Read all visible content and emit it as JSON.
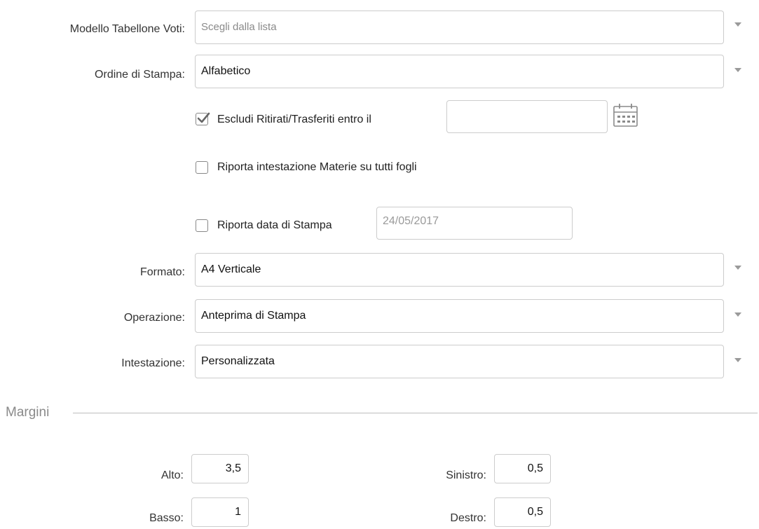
{
  "form": {
    "modello": {
      "label": "Modello Tabellone Voti:",
      "placeholder": "Scegli dalla lista"
    },
    "ordine": {
      "label": "Ordine di Stampa:",
      "value": "Alfabetico"
    },
    "escludi": {
      "label": "Escludi Ritirati/Trasferiti entro il",
      "checked": true,
      "date_value": ""
    },
    "riporta_intestazione": {
      "label": "Riporta intestazione Materie su tutti fogli",
      "checked": false
    },
    "riporta_data": {
      "label": "Riporta data di Stampa",
      "checked": false,
      "date_value": "24/05/2017"
    },
    "formato": {
      "label": "Formato:",
      "value": "A4 Verticale"
    },
    "operazione": {
      "label": "Operazione:",
      "value": "Anteprima di Stampa"
    },
    "intestazione": {
      "label": "Intestazione:",
      "value": "Personalizzata"
    }
  },
  "margini": {
    "title": "Margini",
    "alto": {
      "label": "Alto:",
      "value": "3,5"
    },
    "basso": {
      "label": "Basso:",
      "value": "1"
    },
    "sinistro": {
      "label": "Sinistro:",
      "value": "0,5"
    },
    "destro": {
      "label": "Destro:",
      "value": "0,5"
    }
  },
  "icons": {
    "dropdown": "caret-down-icon",
    "calendar": "calendar-icon",
    "checkmark": "checkmark-icon"
  },
  "colors": {
    "border": "#cccccc",
    "label_text": "#333333",
    "muted_text": "#8a8a8a",
    "caret": "#9a9a9a"
  }
}
